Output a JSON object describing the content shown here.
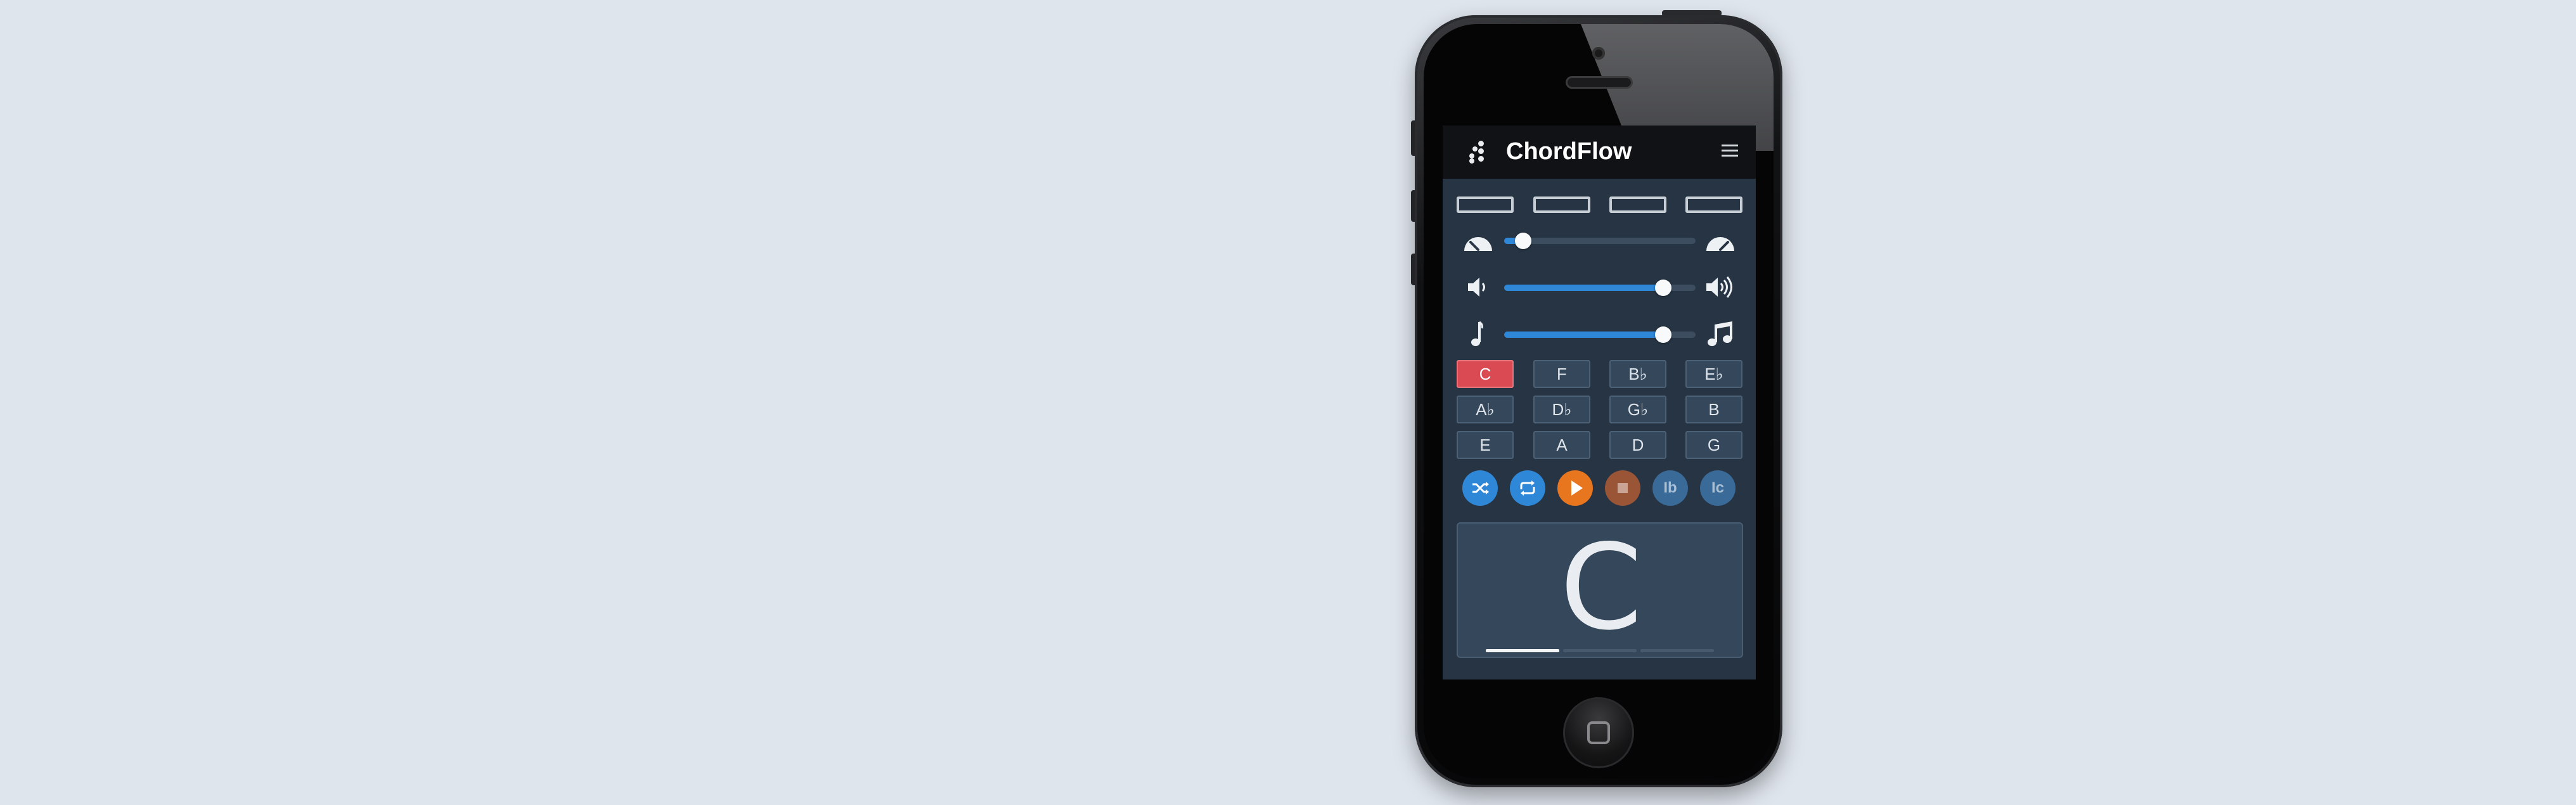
{
  "app": {
    "title": "ChordFlow"
  },
  "header": {
    "logo_icon": "app-logo-icon",
    "menu_icon": "hamburger-menu-icon"
  },
  "segments": [
    {
      "label": ""
    },
    {
      "label": ""
    },
    {
      "label": ""
    },
    {
      "label": ""
    }
  ],
  "sliders": [
    {
      "name": "tempo",
      "left_icon": "slow-gauge-icon",
      "right_icon": "fast-gauge-icon",
      "value": 0.1
    },
    {
      "name": "volume",
      "left_icon": "volume-low-icon",
      "right_icon": "volume-high-icon",
      "value": 0.83
    },
    {
      "name": "note",
      "left_icon": "single-note-icon",
      "right_icon": "double-note-icon",
      "value": 0.83
    }
  ],
  "keys": [
    [
      "C",
      "F",
      "B♭",
      "E♭"
    ],
    [
      "A♭",
      "D♭",
      "G♭",
      "B"
    ],
    [
      "E",
      "A",
      "D",
      "G"
    ]
  ],
  "active_key": "C",
  "controls": {
    "shuffle_icon": "shuffle-icon",
    "repeat_icon": "repeat-icon",
    "play_icon": "play-icon",
    "stop_icon": "stop-icon",
    "inversion_b_label": "Ib",
    "inversion_c_label": "Ic"
  },
  "display": {
    "chord": "C",
    "progress_steps": 3,
    "current_step": 1
  },
  "colors": {
    "accent": "#2f87d8",
    "active_key": "#d94a52",
    "play": "#e8761f",
    "stop": "#9a5537",
    "screen_bg": "#263443"
  }
}
